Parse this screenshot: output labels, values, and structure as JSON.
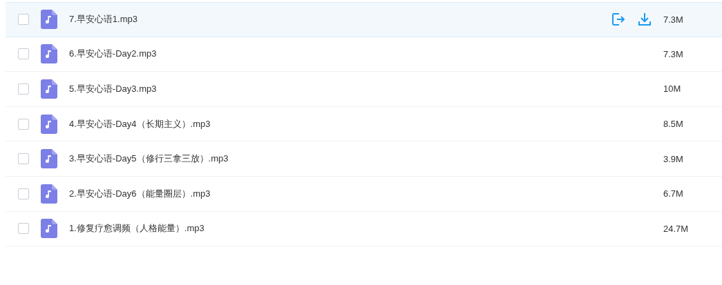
{
  "files": [
    {
      "name": "7.早安心语1.mp3",
      "size": "7.3M",
      "checked": false,
      "hovered": true
    },
    {
      "name": "6.早安心语-Day2.mp3",
      "size": "7.3M",
      "checked": false,
      "hovered": false
    },
    {
      "name": "5.早安心语-Day3.mp3",
      "size": "10M",
      "checked": false,
      "hovered": false
    },
    {
      "name": "4.早安心语-Day4（长期主义）.mp3",
      "size": "8.5M",
      "checked": false,
      "hovered": false
    },
    {
      "name": "3.早安心语-Day5（修行三拿三放）.mp3",
      "size": "3.9M",
      "checked": false,
      "hovered": false
    },
    {
      "name": "2.早安心语-Day6（能量圈层）.mp3",
      "size": "6.7M",
      "checked": false,
      "hovered": false
    },
    {
      "name": "1.修复疗愈调频（人格能量）.mp3",
      "size": "24.7M",
      "checked": false,
      "hovered": false
    }
  ]
}
